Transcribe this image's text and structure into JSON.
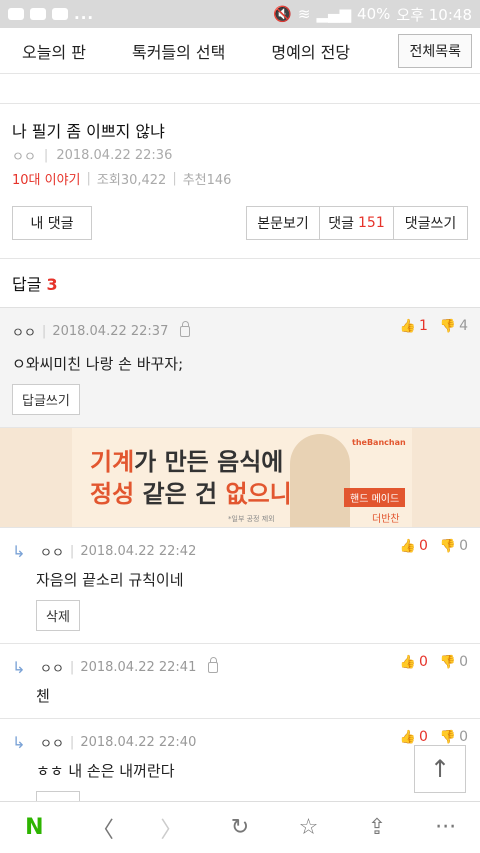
{
  "status": {
    "battery": "40%",
    "time": "오후 10:48",
    "dots": "..."
  },
  "nav": {
    "items": [
      "오늘의 판",
      "톡커들의 선택",
      "명예의 전당"
    ],
    "all": "전체목록"
  },
  "post": {
    "title": "나 필기 좀 이쁘지 않냐",
    "author": "ㅇㅇ",
    "date": "2018.04.22 22:36",
    "category": "10대 이야기",
    "views": "조회30,422",
    "recommend": "추천146"
  },
  "buttons": {
    "my_comments": "내 댓글",
    "view_body": "본문보기",
    "comments_label": "댓글",
    "comments_count": "151",
    "write_comment": "댓글쓰기"
  },
  "replies": {
    "label": "답글",
    "count": "3"
  },
  "best": {
    "author": "ㅇㅇ",
    "date": "2018.04.22 22:37",
    "up": "1",
    "down": "4",
    "text": "ㅇ와씨미친 나랑 손 바꾸자;",
    "btn": "답글쓰기"
  },
  "ad": {
    "line1_a": "기계",
    "line1_b": "가 만든 음식에",
    "line2_a": "정성",
    "line2_b": " 같은 건 ",
    "line2_c": "없으니까!",
    "brand": "theBanchan",
    "badge": "핸드 메이드",
    "brand2": "더반찬",
    "note": "*일부 공정 제외"
  },
  "comments": [
    {
      "author": "ㅇㅇ",
      "date": "2018.04.22 22:42",
      "up": "0",
      "down": "0",
      "text": "자음의 끝소리 규칙이네",
      "btn": "삭제",
      "locked": false
    },
    {
      "author": "ㅇㅇ",
      "date": "2018.04.22 22:41",
      "up": "0",
      "down": "0",
      "text": "첸",
      "btn": "",
      "locked": true
    },
    {
      "author": "ㅇㅇ",
      "date": "2018.04.22 22:40",
      "up": "0",
      "down": "0",
      "text": "ㅎㅎ 내 손은 내꺼란다",
      "btn": "삭제",
      "locked": false
    }
  ],
  "bottom": {
    "n": "N",
    "back": "〈",
    "forward": "〉",
    "reload": "↻",
    "star": "☆",
    "share": "⇪",
    "more": "···"
  }
}
